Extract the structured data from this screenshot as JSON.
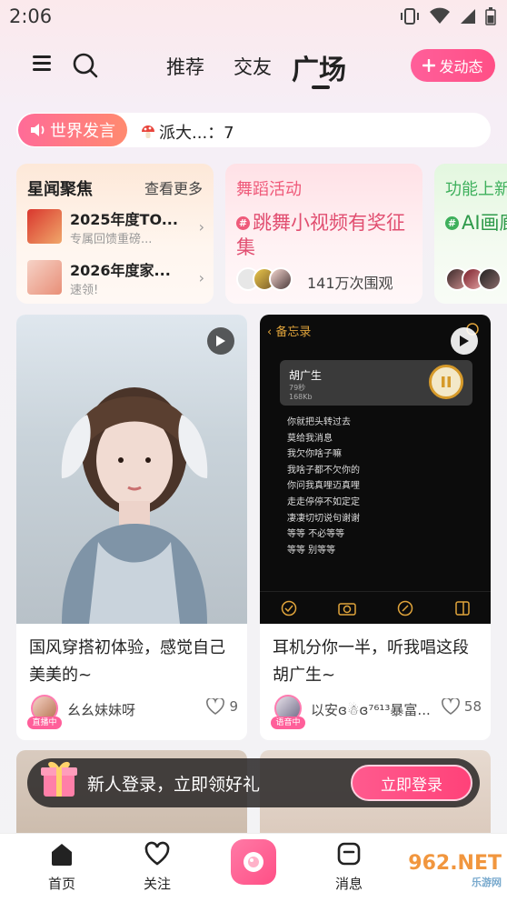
{
  "status_bar": {
    "time": "2:06"
  },
  "header": {
    "tabs": [
      {
        "label": "推荐"
      },
      {
        "label": "交友"
      },
      {
        "label": "广场"
      }
    ],
    "post_button": "发动态"
  },
  "world_speech": {
    "label": "世界发言",
    "message": "派大...：7"
  },
  "topic_cards": {
    "news": {
      "title": "星闻聚焦",
      "more": "查看更多",
      "items": [
        {
          "title": "2025年度TO...",
          "sub": "专属回馈重磅..."
        },
        {
          "title": "2026年度家...",
          "sub": "速领!"
        }
      ]
    },
    "dance": {
      "title": "舞蹈活动",
      "body": "跳舞小视频有奖征集",
      "views": "141万次围观"
    },
    "feature": {
      "title": "功能上新",
      "body": "AI画廊"
    }
  },
  "feed": [
    {
      "title": "国风穿搭初体验，感觉自己美美的~",
      "user": "幺幺妹妹呀",
      "badge": "直播中",
      "likes": "9"
    },
    {
      "title": "耳机分你一半，听我唱这段胡广生~",
      "user": "以安ɞ☃ɞ⁷⁶¹³暴富...",
      "badge": "语音中",
      "likes": "58",
      "memo": {
        "back": "备忘录",
        "audio_name": "胡广生",
        "audio_meta_1": "79秒",
        "audio_meta_2": "168Kb",
        "lines": [
          "你就把头转过去",
          "莫给我消息",
          "我欠你啥子嘛",
          "我啥子都不欠你的",
          "你问我真哩迈真哩",
          "走走停停不如定定",
          "凄凄切切说句谢谢",
          "等等 不必等等",
          "等等 别等等"
        ]
      }
    }
  ],
  "login_banner": {
    "text": "新人登录，立即领好礼",
    "button": "立即登录"
  },
  "bottom_nav": [
    {
      "label": "首页"
    },
    {
      "label": "关注"
    },
    {
      "label": "消息"
    }
  ],
  "watermark": {
    "main": "962.NET",
    "sub": "乐游网"
  },
  "colors": {
    "accent": "#ff4f86",
    "memo_accent": "#e0a43b"
  }
}
